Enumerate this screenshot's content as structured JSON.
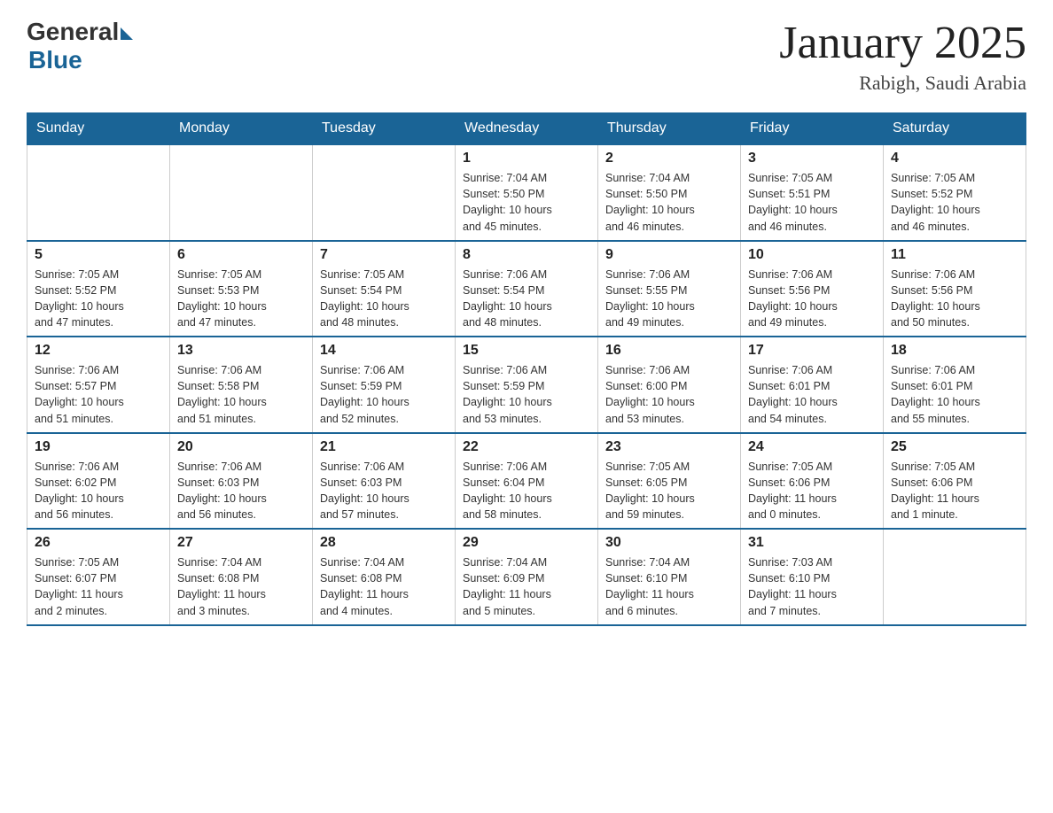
{
  "logo": {
    "general": "General",
    "blue": "Blue"
  },
  "title": "January 2025",
  "location": "Rabigh, Saudi Arabia",
  "days_of_week": [
    "Sunday",
    "Monday",
    "Tuesday",
    "Wednesday",
    "Thursday",
    "Friday",
    "Saturday"
  ],
  "weeks": [
    [
      {
        "day": "",
        "info": ""
      },
      {
        "day": "",
        "info": ""
      },
      {
        "day": "",
        "info": ""
      },
      {
        "day": "1",
        "info": "Sunrise: 7:04 AM\nSunset: 5:50 PM\nDaylight: 10 hours\nand 45 minutes."
      },
      {
        "day": "2",
        "info": "Sunrise: 7:04 AM\nSunset: 5:50 PM\nDaylight: 10 hours\nand 46 minutes."
      },
      {
        "day": "3",
        "info": "Sunrise: 7:05 AM\nSunset: 5:51 PM\nDaylight: 10 hours\nand 46 minutes."
      },
      {
        "day": "4",
        "info": "Sunrise: 7:05 AM\nSunset: 5:52 PM\nDaylight: 10 hours\nand 46 minutes."
      }
    ],
    [
      {
        "day": "5",
        "info": "Sunrise: 7:05 AM\nSunset: 5:52 PM\nDaylight: 10 hours\nand 47 minutes."
      },
      {
        "day": "6",
        "info": "Sunrise: 7:05 AM\nSunset: 5:53 PM\nDaylight: 10 hours\nand 47 minutes."
      },
      {
        "day": "7",
        "info": "Sunrise: 7:05 AM\nSunset: 5:54 PM\nDaylight: 10 hours\nand 48 minutes."
      },
      {
        "day": "8",
        "info": "Sunrise: 7:06 AM\nSunset: 5:54 PM\nDaylight: 10 hours\nand 48 minutes."
      },
      {
        "day": "9",
        "info": "Sunrise: 7:06 AM\nSunset: 5:55 PM\nDaylight: 10 hours\nand 49 minutes."
      },
      {
        "day": "10",
        "info": "Sunrise: 7:06 AM\nSunset: 5:56 PM\nDaylight: 10 hours\nand 49 minutes."
      },
      {
        "day": "11",
        "info": "Sunrise: 7:06 AM\nSunset: 5:56 PM\nDaylight: 10 hours\nand 50 minutes."
      }
    ],
    [
      {
        "day": "12",
        "info": "Sunrise: 7:06 AM\nSunset: 5:57 PM\nDaylight: 10 hours\nand 51 minutes."
      },
      {
        "day": "13",
        "info": "Sunrise: 7:06 AM\nSunset: 5:58 PM\nDaylight: 10 hours\nand 51 minutes."
      },
      {
        "day": "14",
        "info": "Sunrise: 7:06 AM\nSunset: 5:59 PM\nDaylight: 10 hours\nand 52 minutes."
      },
      {
        "day": "15",
        "info": "Sunrise: 7:06 AM\nSunset: 5:59 PM\nDaylight: 10 hours\nand 53 minutes."
      },
      {
        "day": "16",
        "info": "Sunrise: 7:06 AM\nSunset: 6:00 PM\nDaylight: 10 hours\nand 53 minutes."
      },
      {
        "day": "17",
        "info": "Sunrise: 7:06 AM\nSunset: 6:01 PM\nDaylight: 10 hours\nand 54 minutes."
      },
      {
        "day": "18",
        "info": "Sunrise: 7:06 AM\nSunset: 6:01 PM\nDaylight: 10 hours\nand 55 minutes."
      }
    ],
    [
      {
        "day": "19",
        "info": "Sunrise: 7:06 AM\nSunset: 6:02 PM\nDaylight: 10 hours\nand 56 minutes."
      },
      {
        "day": "20",
        "info": "Sunrise: 7:06 AM\nSunset: 6:03 PM\nDaylight: 10 hours\nand 56 minutes."
      },
      {
        "day": "21",
        "info": "Sunrise: 7:06 AM\nSunset: 6:03 PM\nDaylight: 10 hours\nand 57 minutes."
      },
      {
        "day": "22",
        "info": "Sunrise: 7:06 AM\nSunset: 6:04 PM\nDaylight: 10 hours\nand 58 minutes."
      },
      {
        "day": "23",
        "info": "Sunrise: 7:05 AM\nSunset: 6:05 PM\nDaylight: 10 hours\nand 59 minutes."
      },
      {
        "day": "24",
        "info": "Sunrise: 7:05 AM\nSunset: 6:06 PM\nDaylight: 11 hours\nand 0 minutes."
      },
      {
        "day": "25",
        "info": "Sunrise: 7:05 AM\nSunset: 6:06 PM\nDaylight: 11 hours\nand 1 minute."
      }
    ],
    [
      {
        "day": "26",
        "info": "Sunrise: 7:05 AM\nSunset: 6:07 PM\nDaylight: 11 hours\nand 2 minutes."
      },
      {
        "day": "27",
        "info": "Sunrise: 7:04 AM\nSunset: 6:08 PM\nDaylight: 11 hours\nand 3 minutes."
      },
      {
        "day": "28",
        "info": "Sunrise: 7:04 AM\nSunset: 6:08 PM\nDaylight: 11 hours\nand 4 minutes."
      },
      {
        "day": "29",
        "info": "Sunrise: 7:04 AM\nSunset: 6:09 PM\nDaylight: 11 hours\nand 5 minutes."
      },
      {
        "day": "30",
        "info": "Sunrise: 7:04 AM\nSunset: 6:10 PM\nDaylight: 11 hours\nand 6 minutes."
      },
      {
        "day": "31",
        "info": "Sunrise: 7:03 AM\nSunset: 6:10 PM\nDaylight: 11 hours\nand 7 minutes."
      },
      {
        "day": "",
        "info": ""
      }
    ]
  ]
}
